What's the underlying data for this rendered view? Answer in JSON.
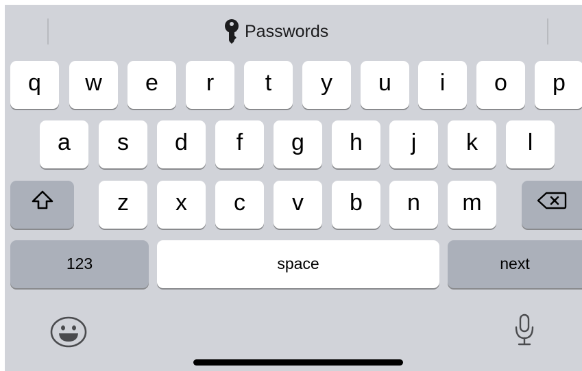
{
  "suggestion": {
    "label": "Passwords",
    "icon": "key-icon"
  },
  "rows": {
    "row1": [
      "q",
      "w",
      "e",
      "r",
      "t",
      "y",
      "u",
      "i",
      "o",
      "p"
    ],
    "row2": [
      "a",
      "s",
      "d",
      "f",
      "g",
      "h",
      "j",
      "k",
      "l"
    ],
    "row3": [
      "z",
      "x",
      "c",
      "v",
      "b",
      "n",
      "m"
    ]
  },
  "function_keys": {
    "shift_icon": "shift-arrow-icon",
    "delete_icon": "delete-backspace-icon",
    "numbers_label": "123",
    "space_label": "space",
    "return_label": "next"
  },
  "bottom_bar": {
    "left_icon": "emoji-smiley-icon",
    "right_icon": "microphone-icon"
  },
  "colors": {
    "keyboard_background": "#d1d3d9",
    "letter_key": "#ffffff",
    "function_key": "#abb0ba",
    "key_shadow": "#898a8d",
    "home_indicator": "#000000"
  }
}
